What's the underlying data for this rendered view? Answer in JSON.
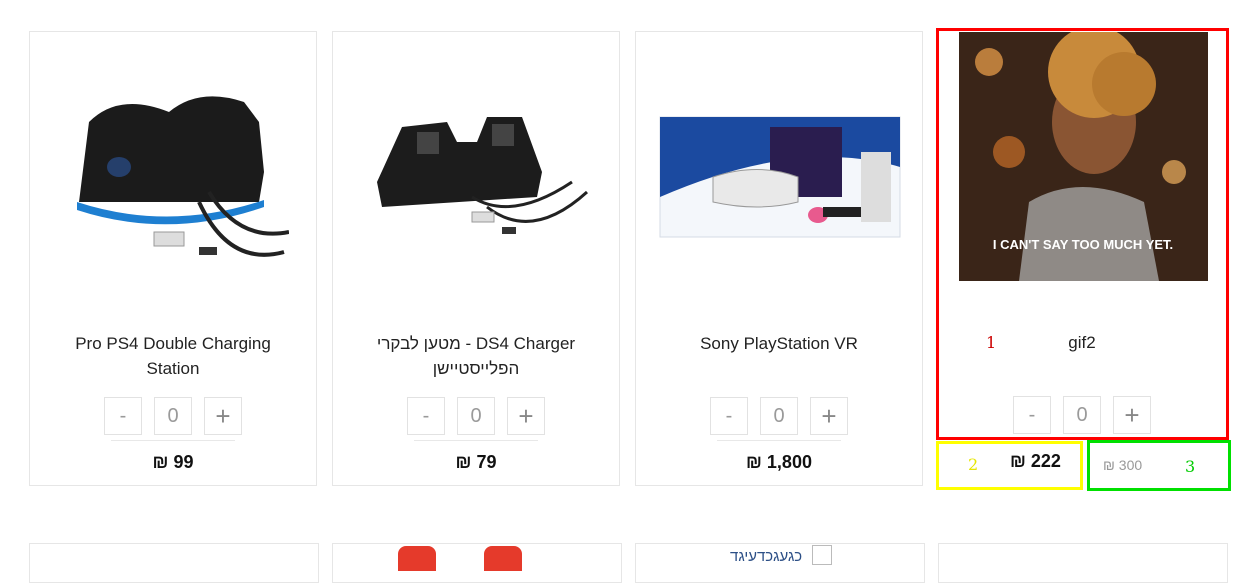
{
  "products": [
    {
      "name": "Pro PS4 Double Charging Station",
      "qty": "0",
      "price": "₪ 99"
    },
    {
      "name": "DS4 Charger - מטען לבקרי הפלייסטיישן",
      "qty": "0",
      "price": "₪ 79"
    },
    {
      "name": "Sony PlayStation VR",
      "qty": "0",
      "price": "₪ 1,800"
    },
    {
      "name": "gif2",
      "qty": "0",
      "price": "₪ 222",
      "old_price": "₪ 300",
      "image_caption": "I CAN'T SAY TOO MUCH YET."
    }
  ],
  "controls": {
    "minus": "-",
    "plus": "+"
  },
  "annotations": {
    "one": "1",
    "two": "2",
    "three": "3"
  },
  "row2": {
    "text": "כגעגכדעיגד"
  },
  "colors": {
    "highlight_red": "#ff0000",
    "highlight_yellow": "#ffff00",
    "highlight_green": "#00e000"
  }
}
